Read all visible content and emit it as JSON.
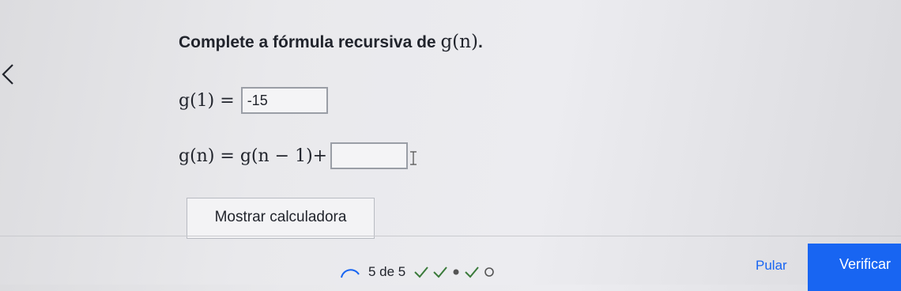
{
  "question": {
    "text": "Complete a fórmula recursiva de ",
    "math": "g(n)",
    "end": "."
  },
  "row1": {
    "lhs": "g(1) =",
    "value": "-15"
  },
  "row2": {
    "lhs": "g(n) = g(n − 1)+",
    "value": ""
  },
  "calculator_label": "Mostrar calculadora",
  "progress": {
    "text": "5 de 5"
  },
  "skip_label": "Pular",
  "check_label": "Verificar",
  "colors": {
    "accent": "#1865f2",
    "check": "#3a7a3a",
    "text": "#21242c"
  }
}
